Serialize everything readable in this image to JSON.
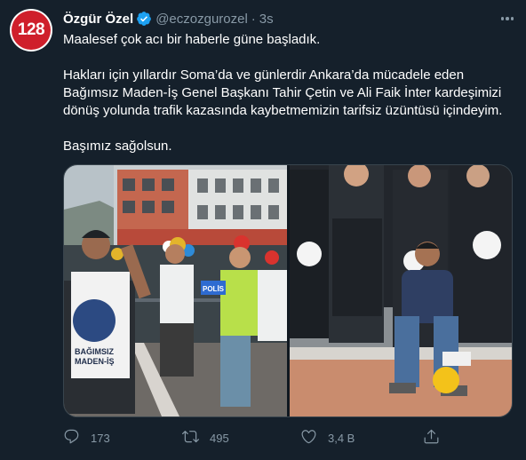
{
  "tweet": {
    "avatar_text": "128",
    "author_name": "Özgür Özel",
    "author_handle": "@eczozgurozel",
    "separator": "·",
    "time": "3s",
    "paragraphs": [
      "Maalesef çok acı bir haberle güne başladık.",
      "Hakları için yıllardır Soma’da ve günlerdir Ankara’da mücadele eden Bağımsız Maden-İş Genel Başkanı Tahir Çetin ve Ali Faik İnter kardeşimizi dönüş yolunda trafik kazasında kaybetmemizin tarifsiz üzüntüsü içindeyim.",
      "Başımız sağolsun."
    ],
    "photo_left_vest_text": "BAĞIMSIZ MADEN-İŞ",
    "photo_left_sign_text": "POLİS",
    "actions": {
      "reply_count": "173",
      "retweet_count": "495",
      "like_count": "3,4 B"
    },
    "colors": {
      "background": "#15202b",
      "secondary_text": "#8899a6",
      "verified": "#1da1f2",
      "avatar_red": "#cf1f2b"
    }
  }
}
